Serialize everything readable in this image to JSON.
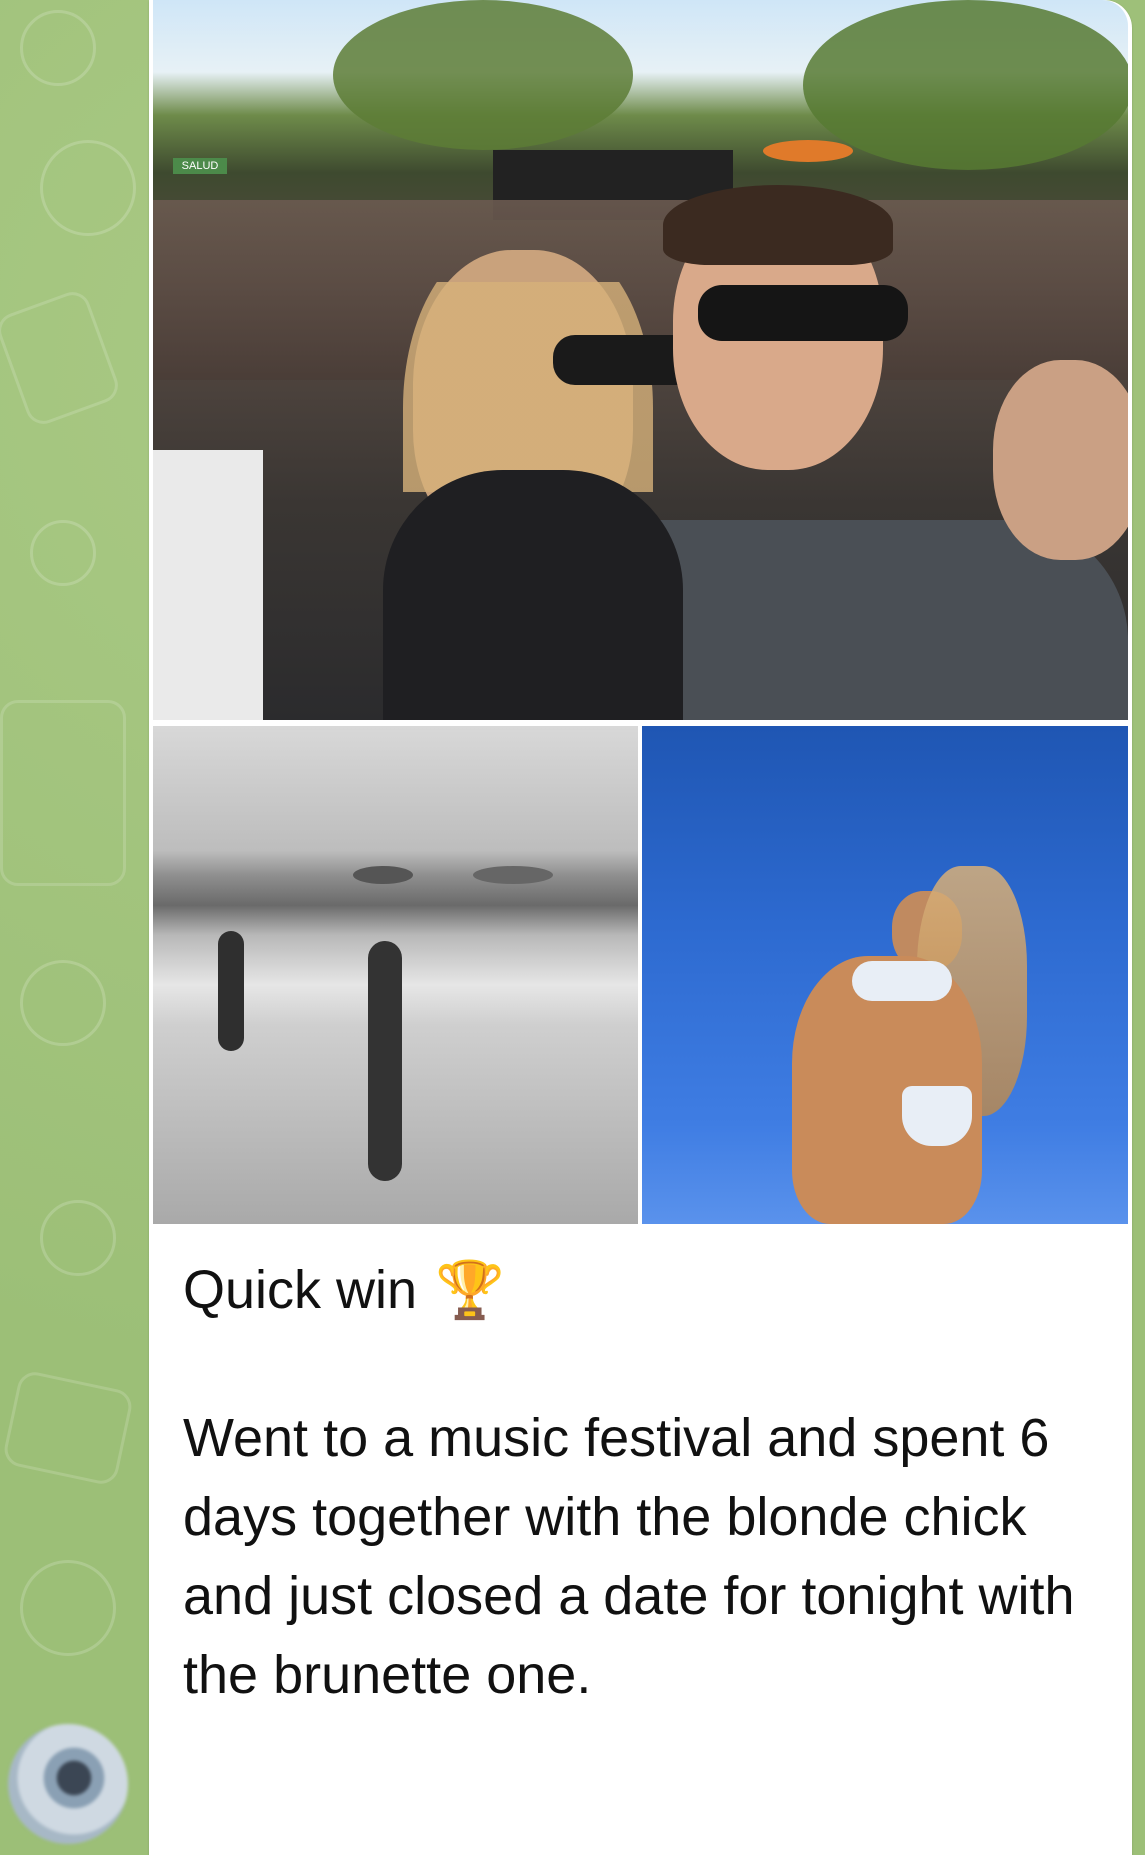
{
  "message": {
    "title": "Quick win",
    "title_emoji": "🏆",
    "body": "Went to a music festival and spent 6 days together with the blonde chick and just closed a date for tonight with the brunette one."
  },
  "photos": {
    "top": {
      "sign_text": "SALUD"
    }
  },
  "icons": [
    "trophy-icon"
  ]
}
